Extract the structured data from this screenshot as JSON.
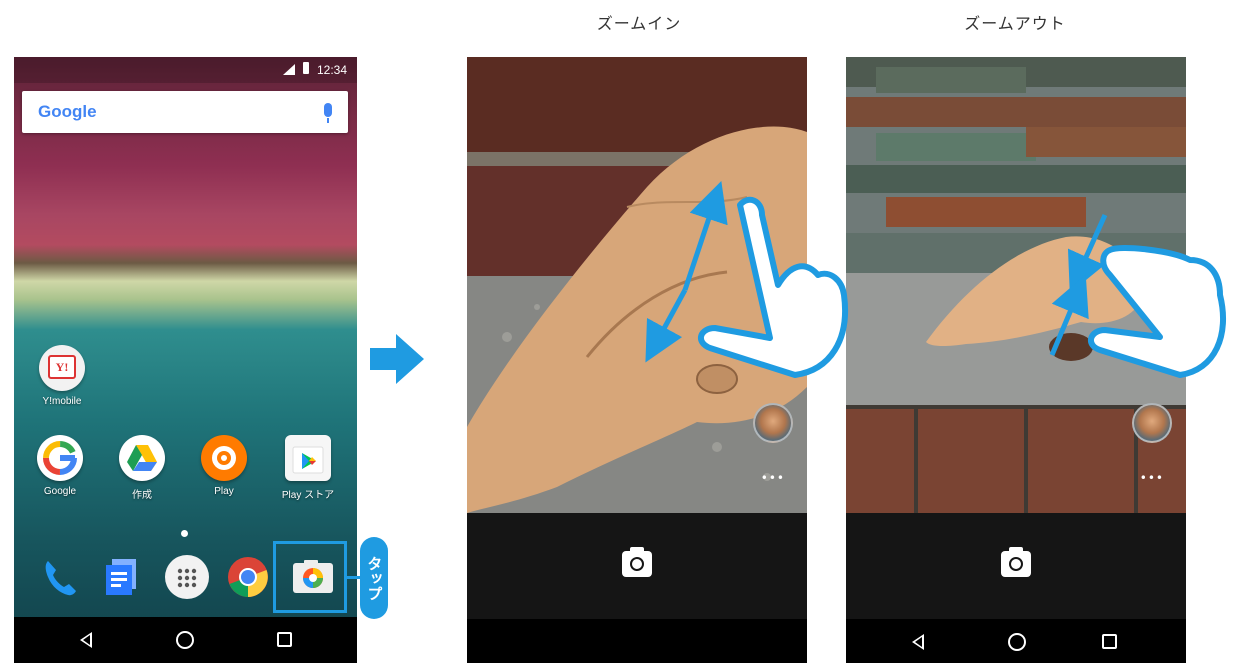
{
  "home": {
    "status_time": "12:34",
    "search_logo": "Google",
    "apps_row1": [
      {
        "label": "Y!mobile",
        "icon": "ymobile-icon",
        "badge": "Y!"
      }
    ],
    "apps_row2": [
      {
        "label": "Google",
        "icon": "google-icon"
      },
      {
        "label": "作成",
        "icon": "drive-icon"
      },
      {
        "label": "Play",
        "icon": "play-music-icon"
      },
      {
        "label": "Play ストア",
        "icon": "play-store-icon"
      }
    ],
    "dock": [
      "phone-icon",
      "messages-icon",
      "app-drawer-icon",
      "chrome-icon",
      "camera-app-icon"
    ]
  },
  "callout": {
    "tap_label": "タップ"
  },
  "captions": {
    "zoom_in": "ズームイン",
    "zoom_out": "ズームアウト"
  },
  "camera": {
    "more_label": "•••"
  },
  "colors": {
    "accent": "#1f9be1",
    "nav_bar": "#000000",
    "shutter_bar": "#151515"
  }
}
